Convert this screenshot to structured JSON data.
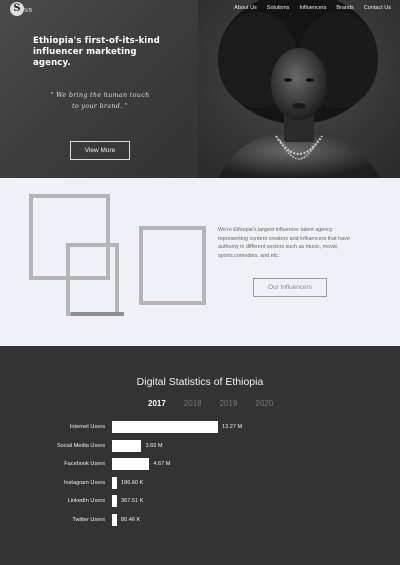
{
  "header": {
    "logo_letter": "S",
    "logo_sub": "SiB",
    "nav": [
      "About Us",
      "Solutions",
      "Influencers",
      "Brands",
      "Contact Us"
    ]
  },
  "hero": {
    "title": "Ethiopia's first-of-its-kind influencer marketing agency.",
    "quote_line1": "\" We bring the human touch",
    "quote_line2": "to your brand. \"",
    "button": "View More"
  },
  "about": {
    "text": "We're Ethiopia's largest influencer talent agency representing content creators and influencers that have authority in different sectors such as music, movie, sports,comedies, and etc.",
    "button": "Our Influencers"
  },
  "stats": {
    "title": "Digital Statistics of Ethiopia",
    "years": [
      "2017",
      "2018",
      "2019",
      "2020"
    ],
    "active_year": "2017"
  },
  "chart_data": {
    "type": "bar",
    "orientation": "horizontal",
    "categories": [
      "Internet Users",
      "Social Media Users",
      "Facebook Users",
      "Instagram Users",
      "LinkedIn Users",
      "Twitter Users"
    ],
    "values": [
      13270000,
      3690000,
      4670000,
      186600,
      367510,
      80460
    ],
    "value_labels": [
      "13.27 M",
      "3.69 M",
      "4.67 M",
      "186.60 K",
      "367.51 K",
      "80.46 K"
    ],
    "bar_color": "#ffffff"
  }
}
